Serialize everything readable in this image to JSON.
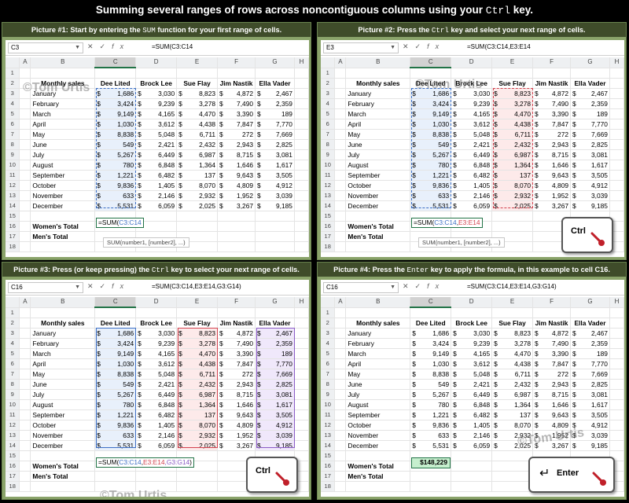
{
  "title": {
    "prefix": "Summing several ranges of rows across noncontiguous columns using your",
    "key": "Ctrl",
    "suffix": "key."
  },
  "panels": [
    {
      "header_prefix": "Picture #1:  Start by entering the",
      "header_key": "SUM",
      "header_suffix": "function for your first range of cells.",
      "namebox": "C3",
      "formula": "=SUM(C3:C14",
      "cell_parts": [
        "=SUM(",
        "C3:C14",
        "",
        "",
        "",
        ""
      ],
      "tooltip": "SUM(number1, [number2], ...)"
    },
    {
      "header_prefix": "Picture #2:  Press the",
      "header_key": "Ctrl",
      "header_suffix": "key and select your next range of cells.",
      "namebox": "E3",
      "formula": "=SUM(C3:C14,E3:E14",
      "cell_parts": [
        "=SUM(",
        "C3:C14",
        ",",
        "E3:E14",
        "",
        ""
      ],
      "tooltip": "SUM(number1, [number2], ...)",
      "keycap": "Ctrl"
    },
    {
      "header_prefix": "Picture #3:  Press (or keep pressing) the",
      "header_key": "Ctrl",
      "header_suffix": "key to select your next range of cells.",
      "namebox": "C16",
      "formula": "=SUM(C3:C14,E3:E14,G3:G14)",
      "cell_parts": [
        "=SUM(",
        "C3:C14",
        ",",
        "E3:E14",
        ",G3:G14",
        ")"
      ],
      "keycap": "Ctrl"
    },
    {
      "header_prefix": "Picture #4:  Press the",
      "header_key": "Enter",
      "header_suffix": "key to apply the formula, in this example to cell C16.",
      "namebox": "C16",
      "formula": "=SUM(C3:C14,E3:E14,G3:G14)",
      "total": "$148,229",
      "keycap": "Enter"
    }
  ],
  "formula_icons": {
    "cancel": "✕",
    "enter": "✓",
    "fx": "fx"
  },
  "columns": [
    "A",
    "B",
    "C",
    "D",
    "E",
    "F",
    "G",
    "H"
  ],
  "headers": [
    "Monthly sales",
    "Dee Lited",
    "Brock Lee",
    "Sue Flay",
    "Jim Nastik",
    "Ella Vader"
  ],
  "months": [
    "January",
    "February",
    "March",
    "April",
    "May",
    "June",
    "July",
    "August",
    "September",
    "October",
    "November",
    "December"
  ],
  "values": [
    [
      "1,686",
      "3,030",
      "8,823",
      "4,872",
      "2,467"
    ],
    [
      "3,424",
      "9,239",
      "3,278",
      "7,490",
      "2,359"
    ],
    [
      "9,149",
      "4,165",
      "4,470",
      "3,390",
      "189"
    ],
    [
      "1,030",
      "3,612",
      "4,438",
      "7,847",
      "7,770"
    ],
    [
      "8,838",
      "5,048",
      "6,711",
      "272",
      "7,669"
    ],
    [
      "549",
      "2,421",
      "2,432",
      "2,943",
      "2,825"
    ],
    [
      "5,267",
      "6,449",
      "6,987",
      "8,715",
      "3,081"
    ],
    [
      "780",
      "6,848",
      "1,364",
      "1,646",
      "1,617"
    ],
    [
      "1,221",
      "6,482",
      "137",
      "9,643",
      "3,505"
    ],
    [
      "9,836",
      "1,405",
      "8,070",
      "4,809",
      "4,912"
    ],
    [
      "633",
      "2,146",
      "2,932",
      "1,952",
      "3,039"
    ],
    [
      "5,531",
      "6,059",
      "2,025",
      "3,267",
      "9,185"
    ]
  ],
  "dollar": "$",
  "labels": {
    "womens_total": "Women's Total",
    "mens_total": "Men's Total"
  },
  "watermark": "©Tom Urtis",
  "colors": {
    "blue_range": "#3d6fc4",
    "red_range": "#d2434f",
    "purple_range": "#8a5bc4",
    "panel_bg": "#8aa36a",
    "header_bg": "#3f4c2a"
  }
}
